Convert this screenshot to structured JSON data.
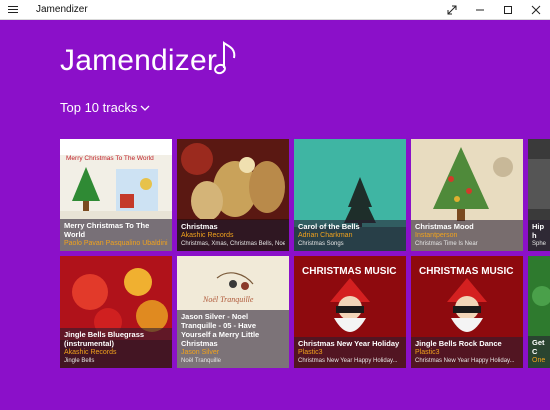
{
  "window": {
    "title": "Jamendizer"
  },
  "header": {
    "app_title": "Jamendizer",
    "selector_label": "Top 10 tracks",
    "accent_color": "#8b10c9"
  },
  "tracks": [
    {
      "title": "Merry Christmas To The World",
      "artist": "Paolo Pavan Pasqualino Ubaldini",
      "tags": ""
    },
    {
      "title": "Christmas",
      "artist": "Akashic Records",
      "tags": "Christmas, Xmas, Christmas Bells, Noel"
    },
    {
      "title": "Carol of the Bells",
      "artist": "Adrian Charkman",
      "tags": "Christmas Songs"
    },
    {
      "title": "Christmas  Mood",
      "artist": "Instantperson",
      "tags": "Christmas Time Is Near"
    },
    {
      "title": "Hip h",
      "artist": "Sphere",
      "tags": ""
    },
    {
      "title": "Jingle Bells Bluegrass (instrumental)",
      "artist": "Akashic Records",
      "tags": "Jingle Bells"
    },
    {
      "title": "Jason Silver - Noel Tranquille - 05 - Have Yourself a Merry Little Christmas",
      "artist": "Jason Silver",
      "tags": "Noël Tranquille"
    },
    {
      "title": "Christmas New Year Holiday",
      "artist": "Plastic3",
      "tags": "Christmas New Year Happy Holiday..."
    },
    {
      "title": "Jingle Bells Rock Dance",
      "artist": "Plastic3",
      "tags": "Christmas New Year Happy Holiday..."
    },
    {
      "title": "Get C",
      "artist": "One",
      "tags": ""
    }
  ],
  "art_text": {
    "track0": "Merry Christmas To The World",
    "track6": "Noël Tranquille",
    "track7": "CHRISTMAS MUSIC",
    "track8": "CHRISTMAS MUSIC"
  }
}
